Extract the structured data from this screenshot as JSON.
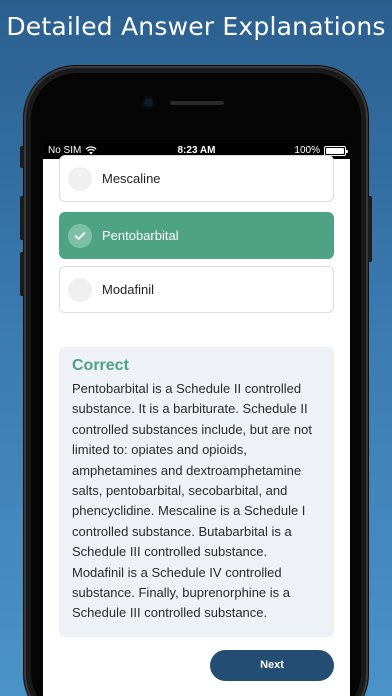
{
  "headline": "Detailed Answer Explanations",
  "status_bar": {
    "carrier": "No SIM",
    "time": "8:23 AM",
    "battery": "100%",
    "icons": [
      "wifi-icon",
      "battery-icon"
    ]
  },
  "options": [
    {
      "label": "Mescaline",
      "selected": false
    },
    {
      "label": "Pentobarbital",
      "selected": true,
      "icon": "checkmark-icon"
    },
    {
      "label": "Modafinil",
      "selected": false
    }
  ],
  "explanation": {
    "title": "Correct",
    "body": "Pentobarbital is a Schedule II controlled substance. It is a barbiturate. Schedule II controlled substances include, but are not limited to: opiates and opioids, amphetamines and dextroamphetamine salts, pentobarbital, secobarbital, and phencyclidine. Mescaline is a Schedule I controlled substance. Butabarbital is a Schedule III controlled substance. Modafinil is a Schedule IV controlled substance. Finally, buprenorphine is a Schedule III controlled substance."
  },
  "next_button": {
    "label": "Next"
  },
  "colors": {
    "correct_green": "#4da383",
    "button_navy": "#234d73",
    "explanation_bg": "#eef2f6"
  }
}
